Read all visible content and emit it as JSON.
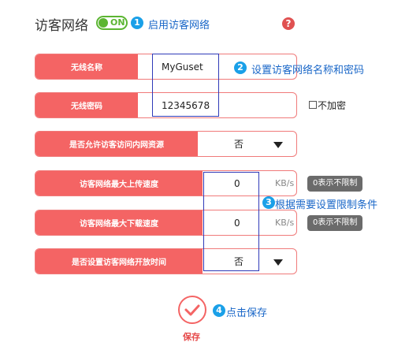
{
  "header": {
    "title": "访客网络",
    "toggle_label": "ON",
    "step1_number": "1",
    "step1_note": "启用访客网络",
    "help_label": "?"
  },
  "wireless_name": {
    "label": "无线名称",
    "value": "MyGuset"
  },
  "wireless_password": {
    "label": "无线密码",
    "value": "12345678"
  },
  "no_encrypt": {
    "label": "不加密",
    "checked": false
  },
  "step2": {
    "number": "2",
    "note": "设置访客网络名称和密码"
  },
  "allow_intranet": {
    "label": "是否允许访客访问内网资源",
    "value": "否"
  },
  "upload_speed": {
    "label": "访客网络最大上传速度",
    "value": "0",
    "unit": "KB/s",
    "hint": "0表示不限制"
  },
  "download_speed": {
    "label": "访客网络最大下载速度",
    "value": "0",
    "unit": "KB/s",
    "hint": "0表示不限制"
  },
  "step3": {
    "number": "3",
    "note": "根据需要设置限制条件"
  },
  "open_time": {
    "label": "是否设置访客网络开放时间",
    "value": "否"
  },
  "step4": {
    "number": "4",
    "note": "点击保存"
  },
  "save": {
    "label": "保存"
  },
  "colors": {
    "accent": "#f46464",
    "toggle_on": "#5bb531",
    "step_badge": "#1aa0e8",
    "note_text": "#1a67c8",
    "frame": "#2f3ab8"
  }
}
